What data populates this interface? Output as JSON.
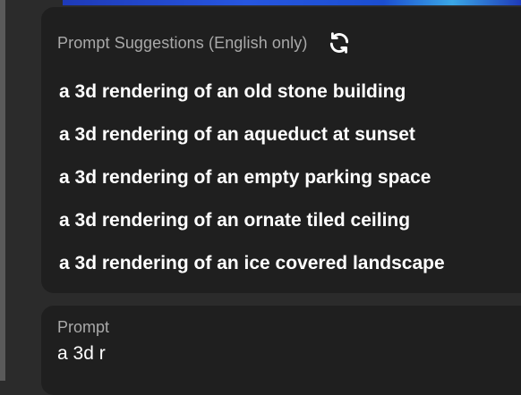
{
  "suggestions": {
    "title": "Prompt Suggestions (English only)",
    "refresh_icon": "refresh-icon",
    "items": [
      {
        "label": "a 3d rendering of an old stone building"
      },
      {
        "label": "a 3d rendering of an aqueduct at sunset"
      },
      {
        "label": "a 3d rendering of an empty parking space"
      },
      {
        "label": "a 3d rendering of an ornate tiled ceiling"
      },
      {
        "label": "a 3d rendering of an ice covered landscape"
      }
    ]
  },
  "prompt": {
    "label": "Prompt",
    "value": "a 3d r"
  },
  "colors": {
    "panel_bg": "#1f1f1f",
    "page_bg": "#2b2b2b",
    "label_text": "#a9a9a9",
    "item_text": "#ffffff"
  }
}
